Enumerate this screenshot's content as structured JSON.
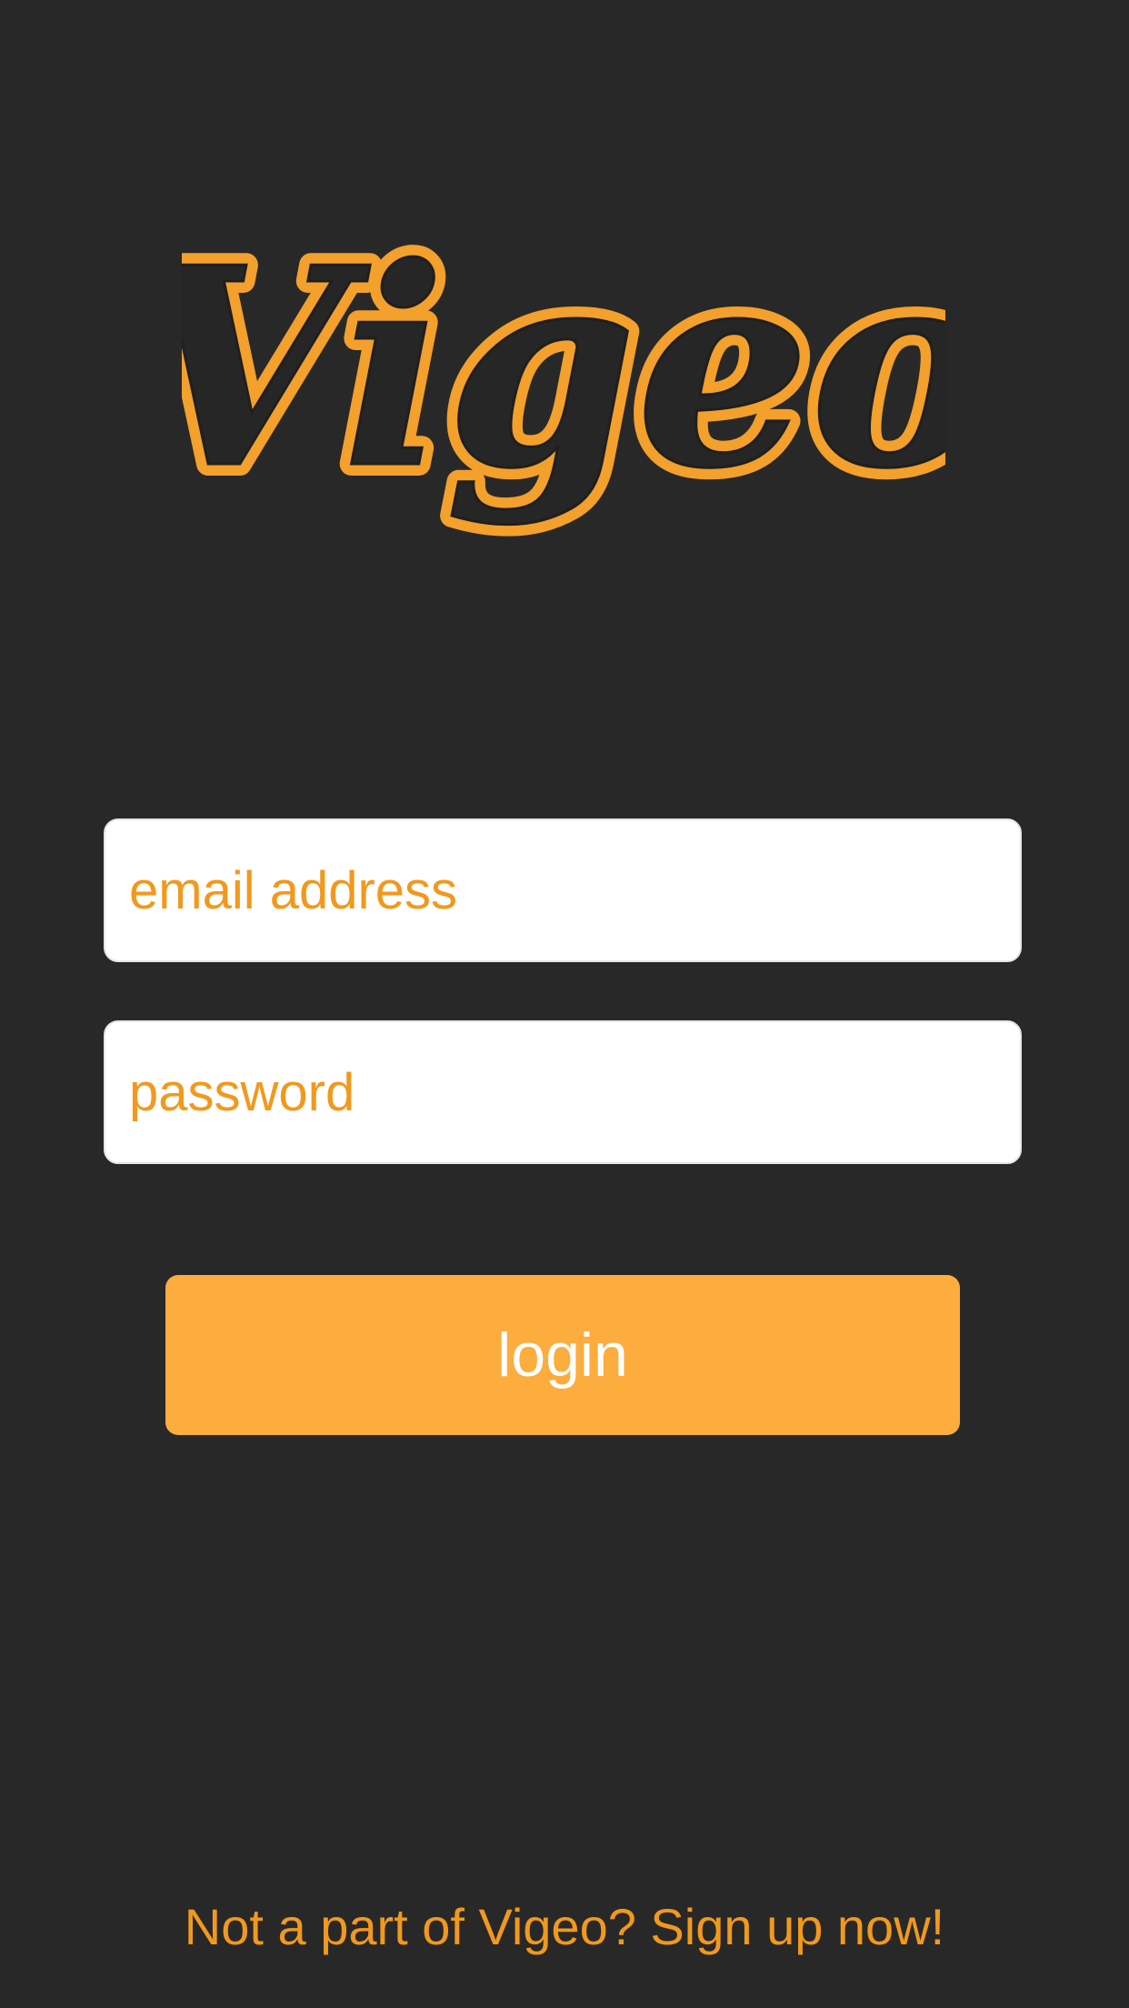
{
  "brand": {
    "logo_text": "Vigeo",
    "accent_color": "#f1991d",
    "button_color": "#fdac3e",
    "background_color": "#282828"
  },
  "form": {
    "email_placeholder": "email address",
    "password_placeholder": "password",
    "login_label": "login"
  },
  "footer": {
    "signup_link": "Not a part of Vigeo? Sign up now!"
  }
}
